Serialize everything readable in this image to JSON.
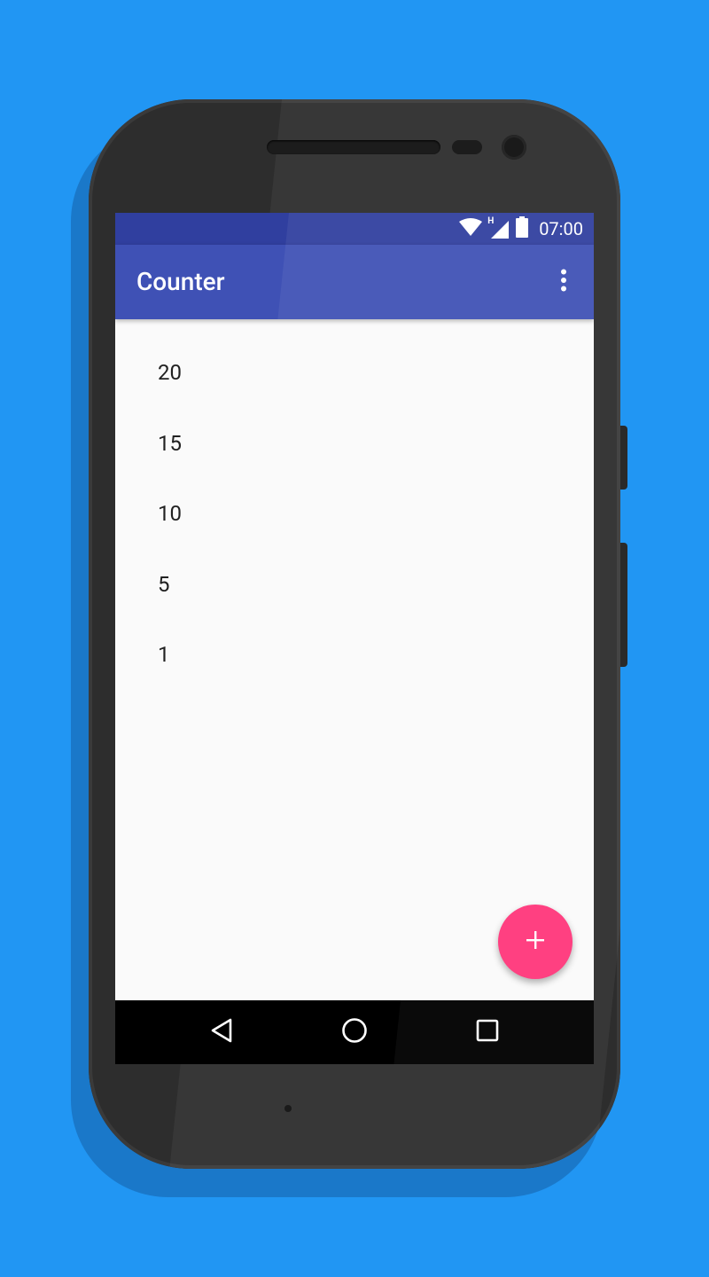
{
  "colors": {
    "background": "#2196F3",
    "status_bar": "#303F9F",
    "app_bar": "#3F51B5",
    "fab": "#FF4081",
    "content_background": "#fafafa",
    "text_primary": "#212121"
  },
  "status_bar": {
    "time": "07:00",
    "network_type": "H",
    "icons": [
      "wifi-icon",
      "cellular-signal-icon",
      "battery-icon"
    ]
  },
  "app_bar": {
    "title": "Counter",
    "overflow_icon": "more-vert-icon"
  },
  "list": {
    "items": [
      "20",
      "15",
      "10",
      "5",
      "1"
    ]
  },
  "fab": {
    "icon": "add-icon",
    "label": "+"
  },
  "navigation_bar": {
    "buttons": [
      "back-icon",
      "home-icon",
      "recents-icon"
    ]
  }
}
